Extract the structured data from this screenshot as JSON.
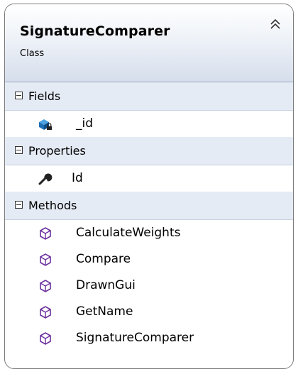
{
  "class": {
    "name": "SignatureComparer",
    "kind": "Class",
    "collapse_icon": "double-chevron-up-icon"
  },
  "sections": {
    "fields": {
      "label": "Fields",
      "items": [
        {
          "name": "_id",
          "icon": "private-field-icon"
        }
      ]
    },
    "properties": {
      "label": "Properties",
      "items": [
        {
          "name": "Id",
          "icon": "property-wrench-icon"
        }
      ]
    },
    "methods": {
      "label": "Methods",
      "items": [
        {
          "name": "CalculateWeights",
          "icon": "method-cube-icon"
        },
        {
          "name": "Compare",
          "icon": "method-cube-icon"
        },
        {
          "name": "DrawnGui",
          "icon": "method-cube-icon"
        },
        {
          "name": "GetName",
          "icon": "method-cube-icon"
        },
        {
          "name": "SignatureComparer",
          "icon": "method-cube-icon"
        }
      ]
    }
  },
  "colors": {
    "method_icon": "#6c2f9e",
    "field_icon": "#1f6fb4",
    "section_header_bg": "#e5ebf5",
    "border": "#7a7a7a"
  }
}
